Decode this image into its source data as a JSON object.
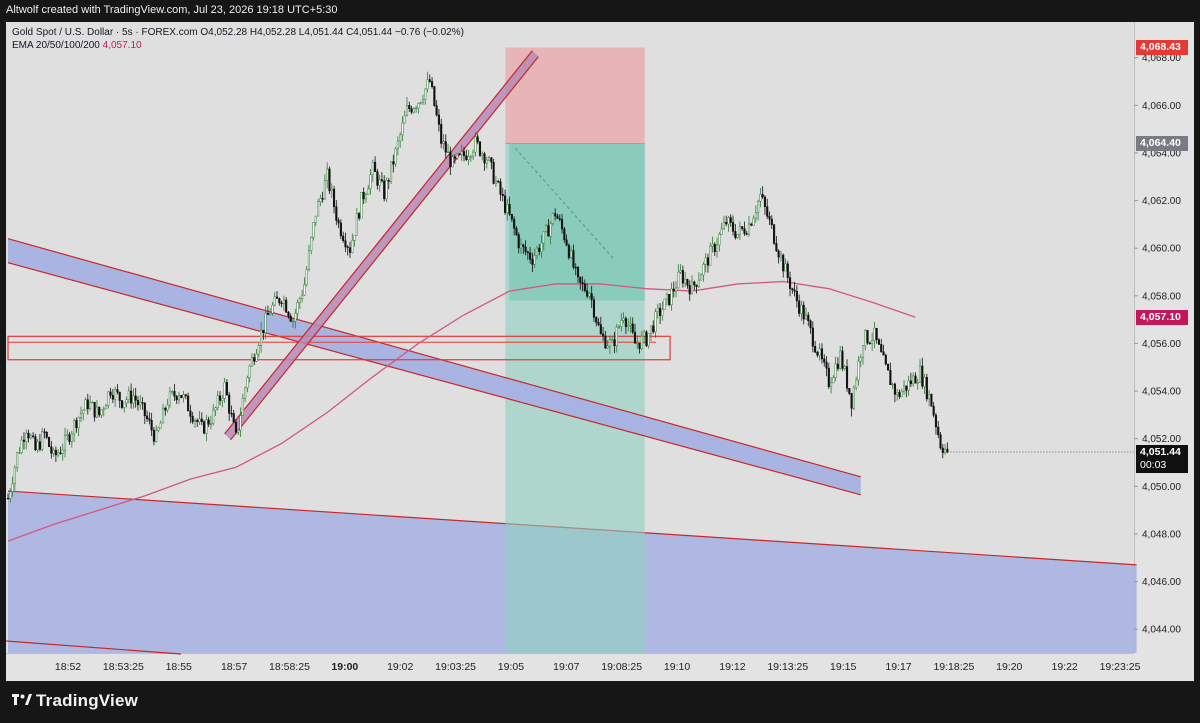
{
  "header": {
    "credit": "Altwolf created with TradingView.com, Jul 23, 2026 19:18 UTC+5:30"
  },
  "legend": {
    "symbol": "Gold Spot / U.S. Dollar · 5s · FOREX.com",
    "ohlc": "O4,052.28  H4,052.28  L4,051.44  C4,051.44  −0.76 (−0.02%)",
    "ema_label": "EMA 20/50/100/200",
    "ema_value": "4,057.10"
  },
  "price_tags": {
    "stop": "4,068.43",
    "entry": "4,064.40",
    "ema": "4,057.10",
    "last": "4,051.44",
    "countdown": "00:03"
  },
  "colors": {
    "up": "#2e7d32",
    "down": "#111111",
    "ema": "#d4577f",
    "stop_zone": "#e9a5aa",
    "target_zone": "#8ed1c0",
    "channel_fill": "#a7b1e3",
    "channel_line": "#c62828"
  },
  "footer": {
    "brand": "TradingView",
    "brand_icon": "tradingview-logo-icon"
  },
  "chart_data": {
    "type": "candlestick",
    "ylim": [
      4043.0,
      4069.5
    ],
    "y_ticks": [
      4044,
      4046,
      4048,
      4050,
      4052,
      4054,
      4056,
      4058,
      4060,
      4062,
      4064,
      4066,
      4068
    ],
    "y_tick_labels": [
      "4,044.00",
      "4,046.00",
      "4,048.00",
      "4,050.00",
      "4,052.00",
      "4,054.00",
      "4,056.00",
      "4,058.00",
      "4,060.00",
      "4,062.00",
      "4,064.00",
      "4,066.00",
      "4,068.00"
    ],
    "x_labels": [
      "18:52",
      "18:53:25",
      "18:55",
      "18:57",
      "18:58:25",
      "19:00",
      "19:02",
      "19:03:25",
      "19:05",
      "19:07",
      "19:08:25",
      "19:10",
      "19:12",
      "19:13:25",
      "19:15",
      "19:17",
      "19:18:25",
      "19:20",
      "19:22",
      "19:23:25"
    ],
    "x_label_bold": "19:00",
    "close_path": [
      [
        0,
        4049.5
      ],
      [
        4,
        4051.3
      ],
      [
        8,
        4052.5
      ],
      [
        12,
        4051.5
      ],
      [
        16,
        4052.2
      ],
      [
        20,
        4051.2
      ],
      [
        25,
        4051.8
      ],
      [
        30,
        4052.8
      ],
      [
        35,
        4053.5
      ],
      [
        40,
        4053.0
      ],
      [
        45,
        4054.1
      ],
      [
        50,
        4053.6
      ],
      [
        55,
        4053.8
      ],
      [
        60,
        4053.0
      ],
      [
        65,
        4052.0
      ],
      [
        70,
        4053.6
      ],
      [
        75,
        4054.0
      ],
      [
        80,
        4053.2
      ],
      [
        85,
        4052.4
      ],
      [
        90,
        4053.0
      ],
      [
        95,
        4054.2
      ],
      [
        100,
        4052.0
      ],
      [
        105,
        4054.7
      ],
      [
        110,
        4056.2
      ],
      [
        115,
        4057.4
      ],
      [
        120,
        4058.0
      ],
      [
        125,
        4057.0
      ],
      [
        130,
        4058.5
      ],
      [
        135,
        4061.5
      ],
      [
        140,
        4063.0
      ],
      [
        145,
        4061.0
      ],
      [
        150,
        4060.0
      ],
      [
        155,
        4062.0
      ],
      [
        160,
        4063.3
      ],
      [
        165,
        4062.3
      ],
      [
        170,
        4064.0
      ],
      [
        175,
        4065.8
      ],
      [
        180,
        4066.2
      ],
      [
        185,
        4067.0
      ],
      [
        190,
        4064.5
      ],
      [
        195,
        4063.5
      ],
      [
        200,
        4063.9
      ],
      [
        205,
        4064.4
      ],
      [
        210,
        4063.8
      ],
      [
        215,
        4062.5
      ],
      [
        220,
        4061.3
      ],
      [
        225,
        4060.0
      ],
      [
        230,
        4059.6
      ],
      [
        235,
        4060.4
      ],
      [
        240,
        4061.5
      ],
      [
        245,
        4060.3
      ],
      [
        250,
        4058.5
      ],
      [
        255,
        4058.2
      ],
      [
        260,
        4056.3
      ],
      [
        265,
        4055.9
      ],
      [
        270,
        4057.3
      ],
      [
        275,
        4056.0
      ],
      [
        280,
        4056.2
      ],
      [
        285,
        4057.2
      ],
      [
        290,
        4057.9
      ],
      [
        295,
        4058.9
      ],
      [
        300,
        4058.3
      ],
      [
        305,
        4059.2
      ],
      [
        310,
        4060.1
      ],
      [
        315,
        4061.1
      ],
      [
        320,
        4060.6
      ],
      [
        325,
        4061.0
      ],
      [
        330,
        4062.2
      ],
      [
        335,
        4060.8
      ],
      [
        340,
        4059.3
      ],
      [
        345,
        4058.0
      ],
      [
        350,
        4057.0
      ],
      [
        355,
        4055.7
      ],
      [
        360,
        4054.4
      ],
      [
        365,
        4055.5
      ],
      [
        370,
        4053.6
      ],
      [
        375,
        4056.2
      ],
      [
        380,
        4056.3
      ],
      [
        385,
        4054.9
      ],
      [
        390,
        4053.8
      ],
      [
        395,
        4054.3
      ],
      [
        400,
        4054.8
      ],
      [
        405,
        4053.5
      ],
      [
        409,
        4051.8
      ],
      [
        412,
        4051.44
      ]
    ],
    "ema_path": [
      [
        0,
        4047.7
      ],
      [
        20,
        4048.4
      ],
      [
        40,
        4049.0
      ],
      [
        60,
        4049.6
      ],
      [
        80,
        4050.3
      ],
      [
        100,
        4050.8
      ],
      [
        120,
        4051.8
      ],
      [
        140,
        4053.1
      ],
      [
        160,
        4054.6
      ],
      [
        180,
        4056.0
      ],
      [
        200,
        4057.2
      ],
      [
        220,
        4058.2
      ],
      [
        240,
        4058.5
      ],
      [
        260,
        4058.5
      ],
      [
        280,
        4058.3
      ],
      [
        300,
        4058.2
      ],
      [
        320,
        4058.5
      ],
      [
        340,
        4058.6
      ],
      [
        360,
        4058.3
      ],
      [
        380,
        4057.7
      ],
      [
        398,
        4057.1
      ]
    ],
    "last_price": 4051.44,
    "position": {
      "stop": 4068.43,
      "entry": 4064.4,
      "target_top": 4064.4,
      "target_bottom": 4043.0,
      "x_start": 212,
      "x_end": 274
    },
    "annotations": [
      {
        "type": "channel",
        "name": "rising-channel",
        "from": [
          95,
          4052.2
        ],
        "to": [
          230,
          4068.3
        ]
      },
      {
        "type": "channel",
        "name": "falling-channel",
        "from": [
          0,
          4060.4
        ],
        "to": [
          374,
          4050.4
        ]
      },
      {
        "type": "zone",
        "name": "support-zone",
        "x_from": 0,
        "x_to": 286,
        "y_from": 4055.4,
        "y_to": 4056.3
      },
      {
        "type": "channel",
        "name": "wide-channel",
        "from": [
          0,
          4049.8
        ],
        "to": [
          495,
          4046.7
        ]
      }
    ]
  }
}
